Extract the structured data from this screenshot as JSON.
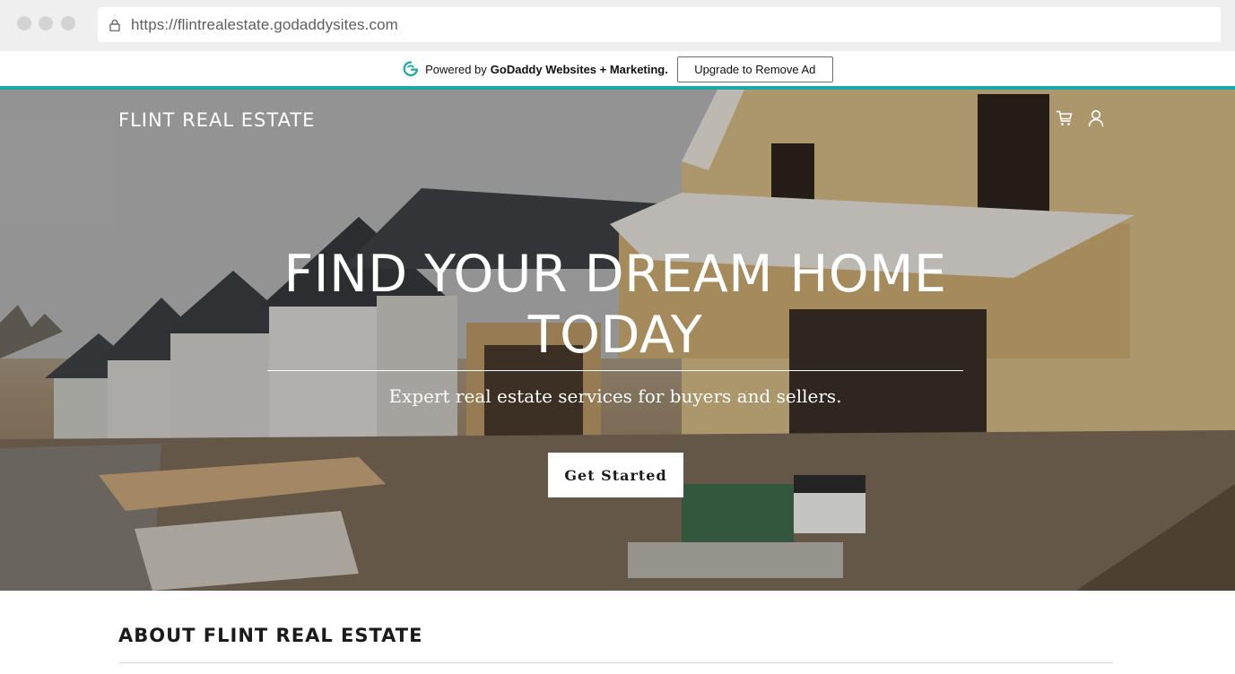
{
  "browser": {
    "url": "https://flintrealestate.godaddysites.com",
    "icons": [
      "window-dot-icon",
      "lock-icon"
    ]
  },
  "ad_bar": {
    "powered_by": "Powered by",
    "brand": "GoDaddy Websites + Marketing.",
    "upgrade_label": "Upgrade to Remove Ad",
    "logo_icon": "godaddy-logo-icon",
    "accent_color": "#1ba7a3"
  },
  "header": {
    "site_name": "FLINT REAL ESTATE",
    "icons": [
      "cart-icon",
      "user-icon"
    ]
  },
  "hero": {
    "headline": "FIND YOUR DREAM HOME TODAY",
    "tagline": "Expert real estate services for buyers and sellers.",
    "cta_label": "Get Started",
    "image_subject": "houses-under-construction-photo"
  },
  "about": {
    "title": "ABOUT FLINT REAL ESTATE"
  }
}
